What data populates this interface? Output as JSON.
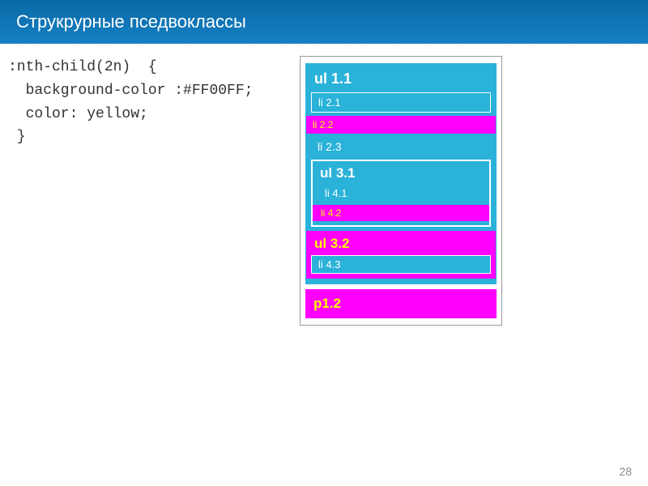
{
  "slide": {
    "title": "Струкрурные пседвоклассы",
    "page_number": "28"
  },
  "code": {
    "line1": ":nth-child(2n)  {",
    "line2": "  background-color :#FF00FF;",
    "line3": "  color: yellow;",
    "line4": " }"
  },
  "diagram": {
    "ul11": "ul 1.1",
    "li21": "li 2.1",
    "li22": "li 2.2",
    "li23": "li 2.3",
    "ul31": "ul 3.1",
    "li41": "li 4.1",
    "li42": "li 4.2",
    "ul32": "ul 3.2",
    "li43": "li 4.3",
    "p12": "p1.2"
  },
  "colors": {
    "cyan": "#2ab2d9",
    "magenta": "#ff00ff",
    "yellow": "#ffff00",
    "header_blue": "#1580c2"
  }
}
